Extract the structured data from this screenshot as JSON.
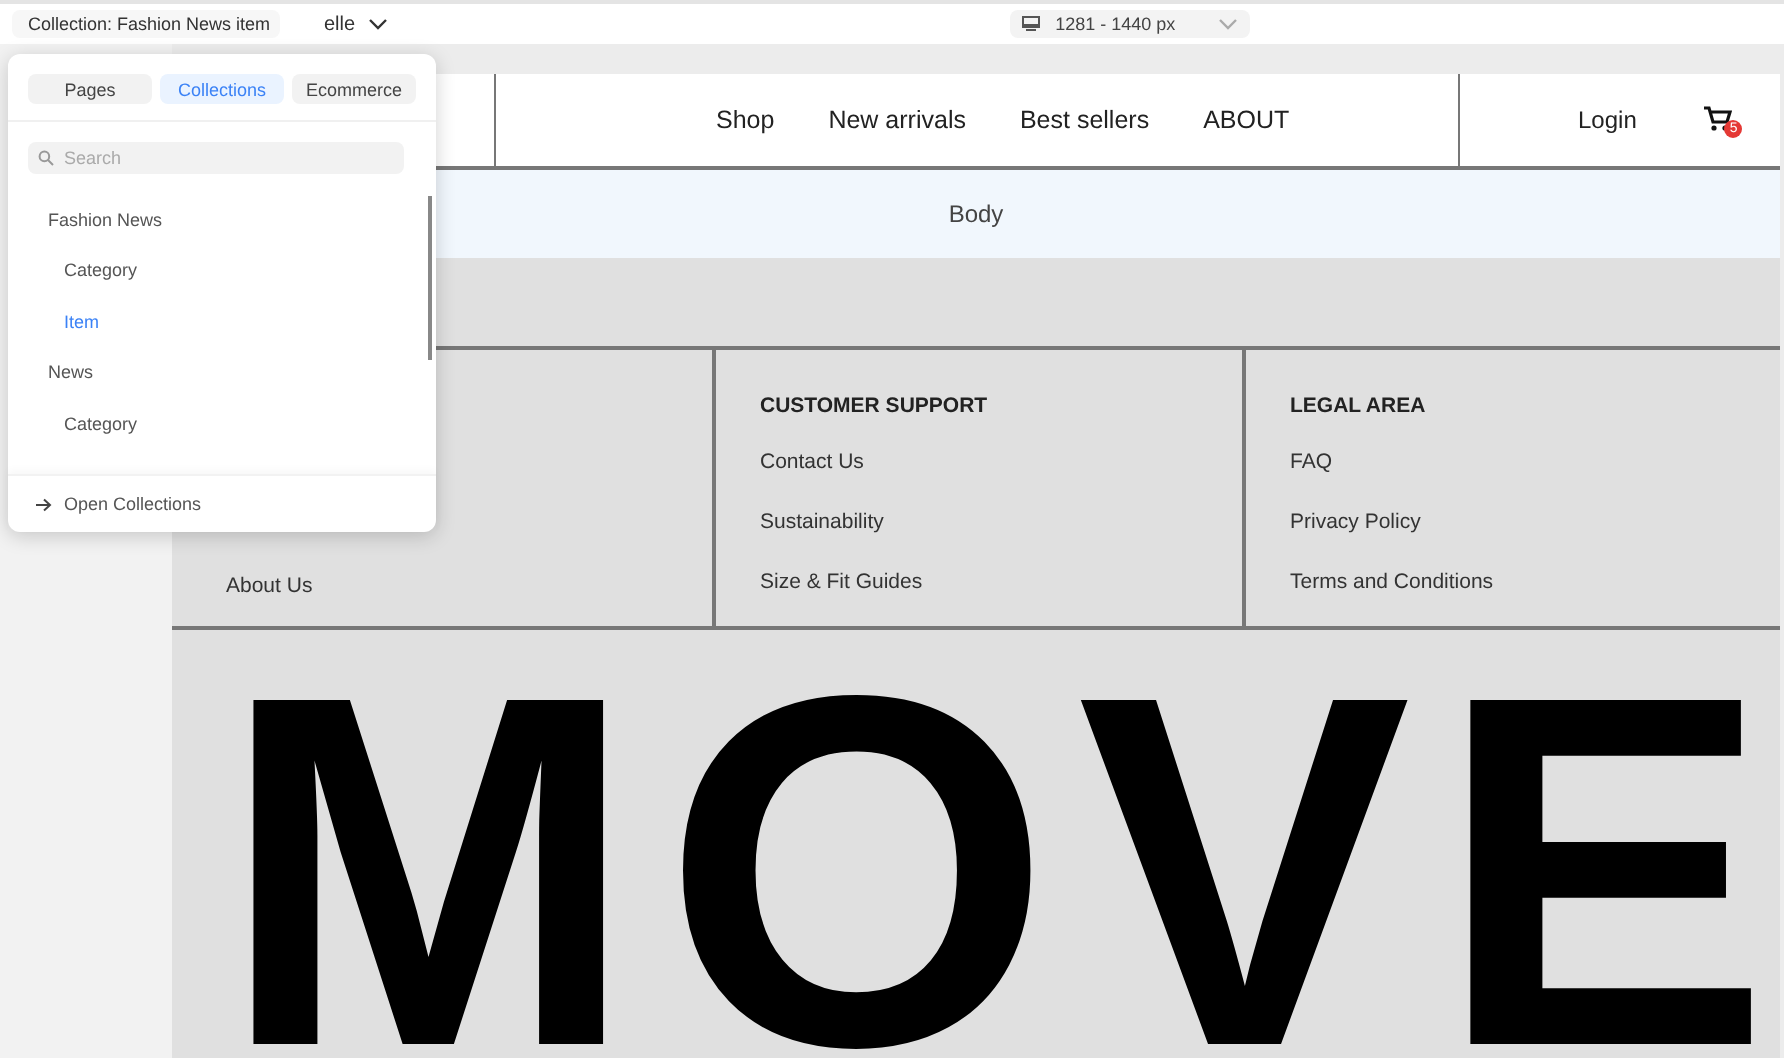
{
  "toolbar": {
    "page_label": "Collection: Fashion News item",
    "variant": "elle",
    "breakpoint": "1281  - 1440 px"
  },
  "popup": {
    "tabs": [
      {
        "label": "Pages",
        "selected": false
      },
      {
        "label": "Collections",
        "selected": true
      },
      {
        "label": "Ecommerce",
        "selected": false
      }
    ],
    "search": {
      "placeholder": "Search"
    },
    "tree": [
      {
        "label": "Fashion News",
        "selected": false,
        "children": [
          {
            "label": "Category",
            "selected": false
          },
          {
            "label": "Item",
            "selected": true
          }
        ]
      },
      {
        "label": "News",
        "selected": false,
        "children": [
          {
            "label": "Category",
            "selected": false
          }
        ]
      }
    ],
    "footer_link": "Open Collections"
  },
  "site": {
    "nav": [
      "Shop",
      "New arrivals",
      "Best sellers",
      "ABOUT"
    ],
    "login": "Login",
    "cart_badge": "5",
    "body_label": "Body",
    "footer_columns": [
      {
        "links": [
          "About Us"
        ]
      },
      {
        "heading": "CUSTOMER SUPPORT",
        "links": [
          "Contact Us",
          "Sustainability",
          "Size & Fit Guides"
        ]
      },
      {
        "heading": "LEGAL AREA",
        "links": [
          "FAQ",
          "Privacy Policy",
          "Terms and Conditions"
        ]
      }
    ],
    "hero": "MOVE"
  }
}
